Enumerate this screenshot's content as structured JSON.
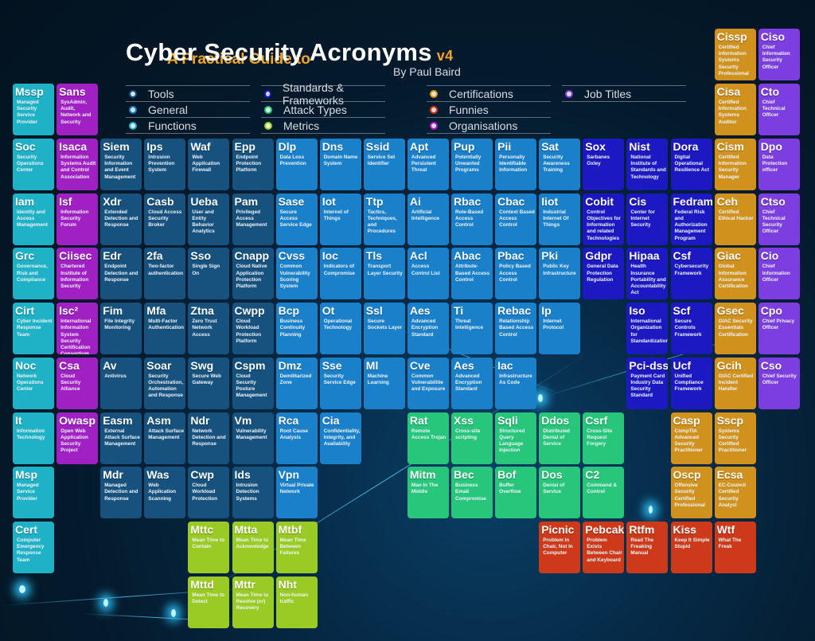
{
  "header": {
    "subtitle": "A Practical Guide to",
    "title": "Cyber Security Acronyms",
    "version": "v4",
    "author": "By Paul Baird"
  },
  "legend": [
    {
      "key": "tools",
      "label": "Tools",
      "color": "#17527e"
    },
    {
      "key": "general",
      "label": "General",
      "color": "#1a80c9"
    },
    {
      "key": "functions",
      "label": "Functions",
      "color": "#1fb1c6"
    },
    {
      "key": "standards",
      "label": "Standards & Frameworks",
      "color": "#1d19c2"
    },
    {
      "key": "attack",
      "label": "Attack Types",
      "color": "#27c67a"
    },
    {
      "key": "metrics",
      "label": "Metrics",
      "color": "#9acb24"
    },
    {
      "key": "certs",
      "label": "Certifications",
      "color": "#d1921d"
    },
    {
      "key": "funnies",
      "label": "Funnies",
      "color": "#cc3a1a"
    },
    {
      "key": "orgs",
      "label": "Organisations",
      "color": "#a120c4"
    },
    {
      "key": "jobs",
      "label": "Job Titles",
      "color": "#7c3ee0"
    }
  ],
  "tiles": [
    {
      "abbr": "Cissp",
      "full": "Certified Information Systems Security Professional",
      "cat": "certs",
      "col": 16,
      "row": 0
    },
    {
      "abbr": "Ciso",
      "full": "Chief Information Security Officer",
      "cat": "jobs",
      "col": 17,
      "row": 0
    },
    {
      "abbr": "Mssp",
      "full": "Managed Security Service Provider",
      "cat": "functions",
      "col": 0,
      "row": 1
    },
    {
      "abbr": "Sans",
      "full": "SysAdmin, Audit, Network and Security",
      "cat": "orgs",
      "col": 1,
      "row": 1
    },
    {
      "abbr": "Cisa",
      "full": "Certified Information Systems Auditor",
      "cat": "certs",
      "col": 16,
      "row": 1
    },
    {
      "abbr": "Cto",
      "full": "Chief Technical Officer",
      "cat": "jobs",
      "col": 17,
      "row": 1
    },
    {
      "abbr": "Soc",
      "full": "Security Operations Center",
      "cat": "functions",
      "col": 0,
      "row": 2
    },
    {
      "abbr": "Isaca",
      "full": "Information Systems Audit and Control Association",
      "cat": "orgs",
      "col": 1,
      "row": 2
    },
    {
      "abbr": "Siem",
      "full": "Security Information and Event Management",
      "cat": "tools",
      "col": 2,
      "row": 2
    },
    {
      "abbr": "Ips",
      "full": "Intrusion Prevention System",
      "cat": "tools",
      "col": 3,
      "row": 2
    },
    {
      "abbr": "Waf",
      "full": "Web Application Firewall",
      "cat": "tools",
      "col": 4,
      "row": 2
    },
    {
      "abbr": "Epp",
      "full": "Endpoint Protection Platform",
      "cat": "tools",
      "col": 5,
      "row": 2
    },
    {
      "abbr": "Dlp",
      "full": "Data Loss Prevention",
      "cat": "general",
      "col": 6,
      "row": 2
    },
    {
      "abbr": "Dns",
      "full": "Domain Name System",
      "cat": "general",
      "col": 7,
      "row": 2
    },
    {
      "abbr": "Ssid",
      "full": "Service Set Identifier",
      "cat": "general",
      "col": 8,
      "row": 2
    },
    {
      "abbr": "Apt",
      "full": "Advanced Persistent Threat",
      "cat": "general",
      "col": 9,
      "row": 2
    },
    {
      "abbr": "Pup",
      "full": "Potentially Unwanted Programs",
      "cat": "general",
      "col": 10,
      "row": 2
    },
    {
      "abbr": "Pii",
      "full": "Personally Identifiable Information",
      "cat": "general",
      "col": 11,
      "row": 2
    },
    {
      "abbr": "Sat",
      "full": "Security Awareness Training",
      "cat": "general",
      "col": 12,
      "row": 2
    },
    {
      "abbr": "Sox",
      "full": "Sarbanes Oxley",
      "cat": "standards",
      "col": 13,
      "row": 2
    },
    {
      "abbr": "Nist",
      "full": "National Institute of Standards and Technology",
      "cat": "standards",
      "col": 14,
      "row": 2
    },
    {
      "abbr": "Dora",
      "full": "Digital Operational Resilience Act",
      "cat": "standards",
      "col": 15,
      "row": 2
    },
    {
      "abbr": "Cism",
      "full": "Certified Information Security Manager",
      "cat": "certs",
      "col": 16,
      "row": 2
    },
    {
      "abbr": "Dpo",
      "full": "Data Protection officer",
      "cat": "jobs",
      "col": 17,
      "row": 2
    },
    {
      "abbr": "Iam",
      "full": "Identity and Access Management",
      "cat": "functions",
      "col": 0,
      "row": 3
    },
    {
      "abbr": "Isf",
      "full": "Information Security Forum",
      "cat": "orgs",
      "col": 1,
      "row": 3
    },
    {
      "abbr": "Xdr",
      "full": "Extended Detection and Response",
      "cat": "tools",
      "col": 2,
      "row": 3
    },
    {
      "abbr": "Casb",
      "full": "Cloud Access Security Broker",
      "cat": "tools",
      "col": 3,
      "row": 3
    },
    {
      "abbr": "Ueba",
      "full": "User and Entity Behavior Analytics",
      "cat": "tools",
      "col": 4,
      "row": 3
    },
    {
      "abbr": "Pam",
      "full": "Privileged Access Management",
      "cat": "tools",
      "col": 5,
      "row": 3
    },
    {
      "abbr": "Sase",
      "full": "Secure Access Service Edge",
      "cat": "general",
      "col": 6,
      "row": 3
    },
    {
      "abbr": "Iot",
      "full": "Internet of Things",
      "cat": "general",
      "col": 7,
      "row": 3
    },
    {
      "abbr": "Ttp",
      "full": "Tactics, Techniques, and Procedures",
      "cat": "general",
      "col": 8,
      "row": 3
    },
    {
      "abbr": "Ai",
      "full": "Artificial Intelligence",
      "cat": "general",
      "col": 9,
      "row": 3
    },
    {
      "abbr": "Rbac",
      "full": "Role-Based Access Control",
      "cat": "general",
      "col": 10,
      "row": 3
    },
    {
      "abbr": "Cbac",
      "full": "Context Based Access Control",
      "cat": "general",
      "col": 11,
      "row": 3
    },
    {
      "abbr": "Iiot",
      "full": "Industrial Internet Of Things",
      "cat": "general",
      "col": 12,
      "row": 3
    },
    {
      "abbr": "Cobit",
      "full": "Control Objectives for Information and related Technologies",
      "cat": "standards",
      "col": 13,
      "row": 3
    },
    {
      "abbr": "Cis",
      "full": "Center for Internet Security",
      "cat": "standards",
      "col": 14,
      "row": 3
    },
    {
      "abbr": "Fedramp",
      "full": "Federal Risk and Authorization Management Program",
      "cat": "standards",
      "col": 15,
      "row": 3
    },
    {
      "abbr": "Ceh",
      "full": "Certified Ethical Hacker",
      "cat": "certs",
      "col": 16,
      "row": 3
    },
    {
      "abbr": "Ctso",
      "full": "Chief Technical Security Officer",
      "cat": "jobs",
      "col": 17,
      "row": 3
    },
    {
      "abbr": "Grc",
      "full": "Governance, Risk and Compliance",
      "cat": "functions",
      "col": 0,
      "row": 4
    },
    {
      "abbr": "Ciisec",
      "full": "Chartered Institute of Information Security",
      "cat": "orgs",
      "col": 1,
      "row": 4
    },
    {
      "abbr": "Edr",
      "full": "Endpoint Detection and Response",
      "cat": "tools",
      "col": 2,
      "row": 4
    },
    {
      "abbr": "2fa",
      "full": "Two-factor authentication",
      "cat": "tools",
      "col": 3,
      "row": 4
    },
    {
      "abbr": "Sso",
      "full": "Single Sign On",
      "cat": "tools",
      "col": 4,
      "row": 4
    },
    {
      "abbr": "Cnapp",
      "full": "Cloud Native Application Protection Platform",
      "cat": "tools",
      "col": 5,
      "row": 4
    },
    {
      "abbr": "Cvss",
      "full": "Common Vulnerability Scoring System",
      "cat": "general",
      "col": 6,
      "row": 4
    },
    {
      "abbr": "Ioc",
      "full": "Indicators of Compromise",
      "cat": "general",
      "col": 7,
      "row": 4
    },
    {
      "abbr": "Tls",
      "full": "Transport Layer Security",
      "cat": "general",
      "col": 8,
      "row": 4
    },
    {
      "abbr": "Acl",
      "full": "Access Control List",
      "cat": "general",
      "col": 9,
      "row": 4
    },
    {
      "abbr": "Abac",
      "full": "Attribute-Based Access Control",
      "cat": "general",
      "col": 10,
      "row": 4
    },
    {
      "abbr": "Pbac",
      "full": "Policy Based Access Control",
      "cat": "general",
      "col": 11,
      "row": 4
    },
    {
      "abbr": "Pki",
      "full": "Public Key Infrastructure",
      "cat": "general",
      "col": 12,
      "row": 4
    },
    {
      "abbr": "Gdpr",
      "full": "General Data Protection Regulation",
      "cat": "standards",
      "col": 13,
      "row": 4
    },
    {
      "abbr": "Hipaa",
      "full": "Health Insurance Portability and Accountability Act",
      "cat": "standards",
      "col": 14,
      "row": 4
    },
    {
      "abbr": "Csf",
      "full": "Cybersecurity Framework",
      "cat": "standards",
      "col": 15,
      "row": 4
    },
    {
      "abbr": "Giac",
      "full": "Global Information Assurance Certification",
      "cat": "certs",
      "col": 16,
      "row": 4
    },
    {
      "abbr": "Cio",
      "full": "Chief Information Officer",
      "cat": "jobs",
      "col": 17,
      "row": 4
    },
    {
      "abbr": "Cirt",
      "full": "Cyber Incident Response Team",
      "cat": "functions",
      "col": 0,
      "row": 5
    },
    {
      "abbr": "Isc²",
      "full": "International Information System Security Certification Consortium",
      "cat": "orgs",
      "col": 1,
      "row": 5
    },
    {
      "abbr": "Fim",
      "full": "File Integrity Monitoring",
      "cat": "tools",
      "col": 2,
      "row": 5
    },
    {
      "abbr": "Mfa",
      "full": "Multi-Factor Authentication",
      "cat": "tools",
      "col": 3,
      "row": 5
    },
    {
      "abbr": "Ztna",
      "full": "Zero Trust Network Access",
      "cat": "tools",
      "col": 4,
      "row": 5
    },
    {
      "abbr": "Cwpp",
      "full": "Cloud Workload Protection Platform",
      "cat": "tools",
      "col": 5,
      "row": 5
    },
    {
      "abbr": "Bcp",
      "full": "Business Continuity Planning",
      "cat": "general",
      "col": 6,
      "row": 5
    },
    {
      "abbr": "Ot",
      "full": "Operational Technology",
      "cat": "general",
      "col": 7,
      "row": 5
    },
    {
      "abbr": "Ssl",
      "full": "Secure Sockets Layer",
      "cat": "general",
      "col": 8,
      "row": 5
    },
    {
      "abbr": "Aes",
      "full": "Advanced Encryption Standard",
      "cat": "general",
      "col": 9,
      "row": 5
    },
    {
      "abbr": "Ti",
      "full": "Threat Intelligence",
      "cat": "general",
      "col": 10,
      "row": 5
    },
    {
      "abbr": "Rebac",
      "full": "Relationship Based Access Control",
      "cat": "general",
      "col": 11,
      "row": 5
    },
    {
      "abbr": "Ip",
      "full": "Internet Protocol",
      "cat": "general",
      "col": 12,
      "row": 5
    },
    {
      "abbr": "Iso",
      "full": "International Organization for Standardization",
      "cat": "standards",
      "col": 14,
      "row": 5
    },
    {
      "abbr": "Scf",
      "full": "Secure Controls Framework",
      "cat": "standards",
      "col": 15,
      "row": 5
    },
    {
      "abbr": "Gsec",
      "full": "GIAC Security Essentials Certification",
      "cat": "certs",
      "col": 16,
      "row": 5
    },
    {
      "abbr": "Cpo",
      "full": "Chief Privacy Officer",
      "cat": "jobs",
      "col": 17,
      "row": 5
    },
    {
      "abbr": "Noc",
      "full": "Network Operations Center",
      "cat": "functions",
      "col": 0,
      "row": 6
    },
    {
      "abbr": "Csa",
      "full": "Cloud Security Alliance",
      "cat": "orgs",
      "col": 1,
      "row": 6
    },
    {
      "abbr": "Av",
      "full": "Antivirus",
      "cat": "tools",
      "col": 2,
      "row": 6
    },
    {
      "abbr": "Soar",
      "full": "Security Orchestration, Automation and Response",
      "cat": "tools",
      "col": 3,
      "row": 6
    },
    {
      "abbr": "Swg",
      "full": "Secure Web Gateway",
      "cat": "tools",
      "col": 4,
      "row": 6
    },
    {
      "abbr": "Cspm",
      "full": "Cloud Security Posture Management",
      "cat": "tools",
      "col": 5,
      "row": 6
    },
    {
      "abbr": "Dmz",
      "full": "Demilitarized Zone",
      "cat": "general",
      "col": 6,
      "row": 6
    },
    {
      "abbr": "Sse",
      "full": "Security Service Edge",
      "cat": "general",
      "col": 7,
      "row": 6
    },
    {
      "abbr": "Ml",
      "full": "Machine Learning",
      "cat": "general",
      "col": 8,
      "row": 6
    },
    {
      "abbr": "Cve",
      "full": "Common Vulnerabilitie and Exposure",
      "cat": "general",
      "col": 9,
      "row": 6
    },
    {
      "abbr": "Aes",
      "full": "Advanced Encryption Standard",
      "cat": "general",
      "col": 10,
      "row": 6
    },
    {
      "abbr": "Iac",
      "full": "Infrastructure As Code",
      "cat": "general",
      "col": 11,
      "row": 6
    },
    {
      "abbr": "Pci-dss",
      "full": "Payment Card Industry Data Security Standard",
      "cat": "standards",
      "col": 14,
      "row": 6
    },
    {
      "abbr": "Ucf",
      "full": "Unified Compliance Framework",
      "cat": "standards",
      "col": 15,
      "row": 6
    },
    {
      "abbr": "Gcih",
      "full": "GIAC Certified Incident Handler",
      "cat": "certs",
      "col": 16,
      "row": 6
    },
    {
      "abbr": "Cso",
      "full": "Chief Security Officer",
      "cat": "jobs",
      "col": 17,
      "row": 6
    },
    {
      "abbr": "It",
      "full": "Information Technology",
      "cat": "functions",
      "col": 0,
      "row": 7
    },
    {
      "abbr": "Owasp",
      "full": "Open Web Application Security Project",
      "cat": "orgs",
      "col": 1,
      "row": 7
    },
    {
      "abbr": "Easm",
      "full": "External Attack Surface Management",
      "cat": "tools",
      "col": 2,
      "row": 7
    },
    {
      "abbr": "Asm",
      "full": "Attack Surface Management",
      "cat": "tools",
      "col": 3,
      "row": 7
    },
    {
      "abbr": "Ndr",
      "full": "Network Detection and Response",
      "cat": "tools",
      "col": 4,
      "row": 7
    },
    {
      "abbr": "Vm",
      "full": "Vulnerability Management",
      "cat": "tools",
      "col": 5,
      "row": 7
    },
    {
      "abbr": "Rca",
      "full": "Root Cause Analysis",
      "cat": "general",
      "col": 6,
      "row": 7
    },
    {
      "abbr": "Cia",
      "full": "Confidentiality, Integrity, and Availability",
      "cat": "general",
      "col": 7,
      "row": 7
    },
    {
      "abbr": "Rat",
      "full": "Remote Access Trojan",
      "cat": "attack",
      "col": 9,
      "row": 7
    },
    {
      "abbr": "Xss",
      "full": "Cross-site scripting",
      "cat": "attack",
      "col": 10,
      "row": 7
    },
    {
      "abbr": "Sqli",
      "full": "Structured Query Language Injection",
      "cat": "attack",
      "col": 11,
      "row": 7
    },
    {
      "abbr": "Ddos",
      "full": "Distributed Denial of Service",
      "cat": "attack",
      "col": 12,
      "row": 7
    },
    {
      "abbr": "Csrf",
      "full": "Cross-Site Request Forgery",
      "cat": "attack",
      "col": 13,
      "row": 7
    },
    {
      "abbr": "Casp",
      "full": "CompTIA Advanced Security Practitioner",
      "cat": "certs",
      "col": 15,
      "row": 7
    },
    {
      "abbr": "Sscp",
      "full": "Systems Security Certified Practitioner",
      "cat": "certs",
      "col": 16,
      "row": 7
    },
    {
      "abbr": "Msp",
      "full": "Managed Service Provider",
      "cat": "functions",
      "col": 0,
      "row": 8
    },
    {
      "abbr": "Mdr",
      "full": "Managed Detection and Response",
      "cat": "tools",
      "col": 2,
      "row": 8
    },
    {
      "abbr": "Was",
      "full": "Web Application Scanning",
      "cat": "tools",
      "col": 3,
      "row": 8
    },
    {
      "abbr": "Cwp",
      "full": "Cloud Workload Protection",
      "cat": "tools",
      "col": 4,
      "row": 8
    },
    {
      "abbr": "Ids",
      "full": "Intrusion Detection Systems",
      "cat": "tools",
      "col": 5,
      "row": 8
    },
    {
      "abbr": "Vpn",
      "full": "Virtual Private Network",
      "cat": "general",
      "col": 6,
      "row": 8
    },
    {
      "abbr": "Mitm",
      "full": "Man In The Middle",
      "cat": "attack",
      "col": 9,
      "row": 8
    },
    {
      "abbr": "Bec",
      "full": "Business Email Compromise",
      "cat": "attack",
      "col": 10,
      "row": 8
    },
    {
      "abbr": "Bof",
      "full": "Buffer Overflow",
      "cat": "attack",
      "col": 11,
      "row": 8
    },
    {
      "abbr": "Dos",
      "full": "Denial of Service",
      "cat": "attack",
      "col": 12,
      "row": 8
    },
    {
      "abbr": "C2",
      "full": "Command & Control",
      "cat": "attack",
      "col": 13,
      "row": 8
    },
    {
      "abbr": "Oscp",
      "full": "Offensive Security Certified Professional",
      "cat": "certs",
      "col": 15,
      "row": 8
    },
    {
      "abbr": "Ecsa",
      "full": "EC-Council Certified Security Analyst",
      "cat": "certs",
      "col": 16,
      "row": 8
    },
    {
      "abbr": "Cert",
      "full": "Computer Emergency Response Team",
      "cat": "functions",
      "col": 0,
      "row": 9
    },
    {
      "abbr": "Mttc",
      "full": "Mean Time to Contain",
      "cat": "metrics",
      "col": 4,
      "row": 9
    },
    {
      "abbr": "Mtta",
      "full": "Mean Time to Acknowledge",
      "cat": "metrics",
      "col": 5,
      "row": 9
    },
    {
      "abbr": "Mtbf",
      "full": "Mean Time Between Failures",
      "cat": "metrics",
      "col": 6,
      "row": 9
    },
    {
      "abbr": "Picnic",
      "full": "Problem In Chair, Not In Computer",
      "cat": "funnies",
      "col": 12,
      "row": 9
    },
    {
      "abbr": "Pebcak",
      "full": "Problem Exists Between Chair and Keyboard",
      "cat": "funnies",
      "col": 13,
      "row": 9
    },
    {
      "abbr": "Rtfm",
      "full": "Read The Freaking Manual",
      "cat": "funnies",
      "col": 14,
      "row": 9
    },
    {
      "abbr": "Kiss",
      "full": "Keep It Simple Stupid",
      "cat": "funnies",
      "col": 15,
      "row": 9
    },
    {
      "abbr": "Wtf",
      "full": "What The Freak",
      "cat": "funnies",
      "col": 16,
      "row": 9
    },
    {
      "abbr": "Mttd",
      "full": "Mean Time to Detect",
      "cat": "metrics",
      "col": 4,
      "row": 10
    },
    {
      "abbr": "Mttr",
      "full": "Mean Time to Resolve (or) Recovery",
      "cat": "metrics",
      "col": 5,
      "row": 10
    },
    {
      "abbr": "Nht",
      "full": "Non-human traffic",
      "cat": "metrics",
      "col": 6,
      "row": 10
    }
  ]
}
